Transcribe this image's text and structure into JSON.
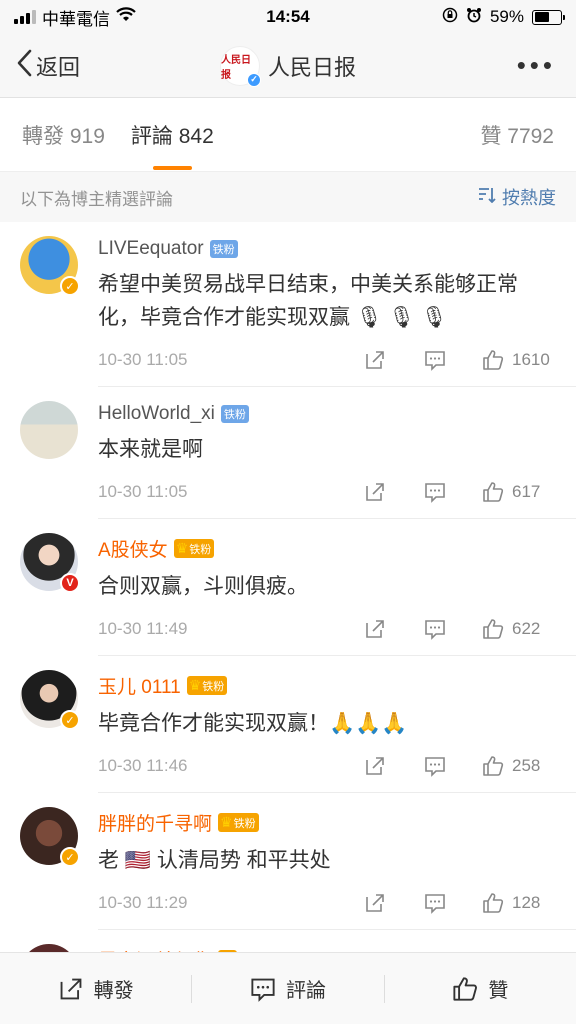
{
  "status_bar": {
    "carrier": "中華電信",
    "time": "14:54",
    "battery": "59%",
    "battery_level": 0.59
  },
  "nav": {
    "back_label": "返回",
    "account_name": "人民日报",
    "avatar_text": "人民日报"
  },
  "tabs": {
    "reposts": "轉發 919",
    "comments": "評論 842",
    "likes": "贊 7792"
  },
  "sort": {
    "hint": "以下為博主精選評論",
    "button": "按熱度"
  },
  "comments": [
    {
      "name": "LIVEequator",
      "vip": false,
      "tag": "铁粉",
      "text": "希望中美贸易战早日结束，中美关系能够正常化，毕竟合作才能实现双赢 🎙 🎙 🎙",
      "time": "10-30 11:05",
      "likes": "1610"
    },
    {
      "name": "HelloWorld_xi",
      "vip": false,
      "tag": "铁粉",
      "text": "本来就是啊",
      "time": "10-30 11:05",
      "likes": "617"
    },
    {
      "name": "A股侠女",
      "vip": true,
      "tag": "铁粉",
      "text": "合则双赢，斗则俱疲。",
      "time": "10-30 11:49",
      "likes": "622"
    },
    {
      "name": "玉儿 0111",
      "vip": true,
      "tag": "铁粉",
      "text": "毕竟合作才能实现双赢！🙏🙏🙏",
      "time": "10-30 11:46",
      "likes": "258"
    },
    {
      "name": "胖胖的千寻啊",
      "vip": true,
      "tag": "铁粉",
      "text": "老 🇺🇸 认清局势 和平共处",
      "time": "10-30 11:29",
      "likes": "128"
    },
    {
      "name": "昼夜温差与你",
      "vip": true,
      "tag": "",
      "text": "",
      "time": "",
      "likes": ""
    }
  ],
  "bottom_bar": {
    "repost": "轉發",
    "comment": "評論",
    "like": "贊"
  },
  "colors": {
    "accent": "#ff8200",
    "link": "#507daf",
    "vip_name": "#f86300"
  }
}
